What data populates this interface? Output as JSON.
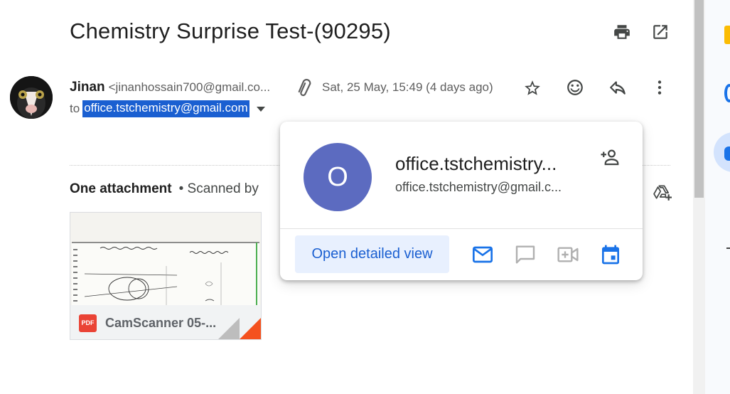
{
  "email": {
    "subject": "Chemistry Surprise Test-(90295)",
    "sender_name": "Jinan",
    "sender_email": "<jinanhossain700@gmail.co...",
    "date": "Sat, 25 May, 15:49 (4 days ago)",
    "to_label": "to",
    "to_address": "office.tstchemistry@gmail.com"
  },
  "icons": {
    "print": "print-icon",
    "open_new_window": "open-in-new-icon",
    "attachment": "paperclip-icon",
    "star": "star-icon",
    "emoji": "emoji-icon",
    "reply": "reply-icon",
    "more": "more-vert-icon",
    "add_to_drive": "add-to-drive-icon"
  },
  "attachments": {
    "title": "One attachment",
    "scan_note": "• Scanned by",
    "items": [
      {
        "name": "CamScanner 05-...",
        "type_label": "PDF"
      }
    ]
  },
  "contact_card": {
    "initial": "O",
    "name": "office.tstchemistry...",
    "email": "office.tstchemistry@gmail.c...",
    "open_detailed_view": "Open detailed view",
    "avatar_color": "#5c6bc0",
    "accent_color": "#1a5fd1"
  }
}
